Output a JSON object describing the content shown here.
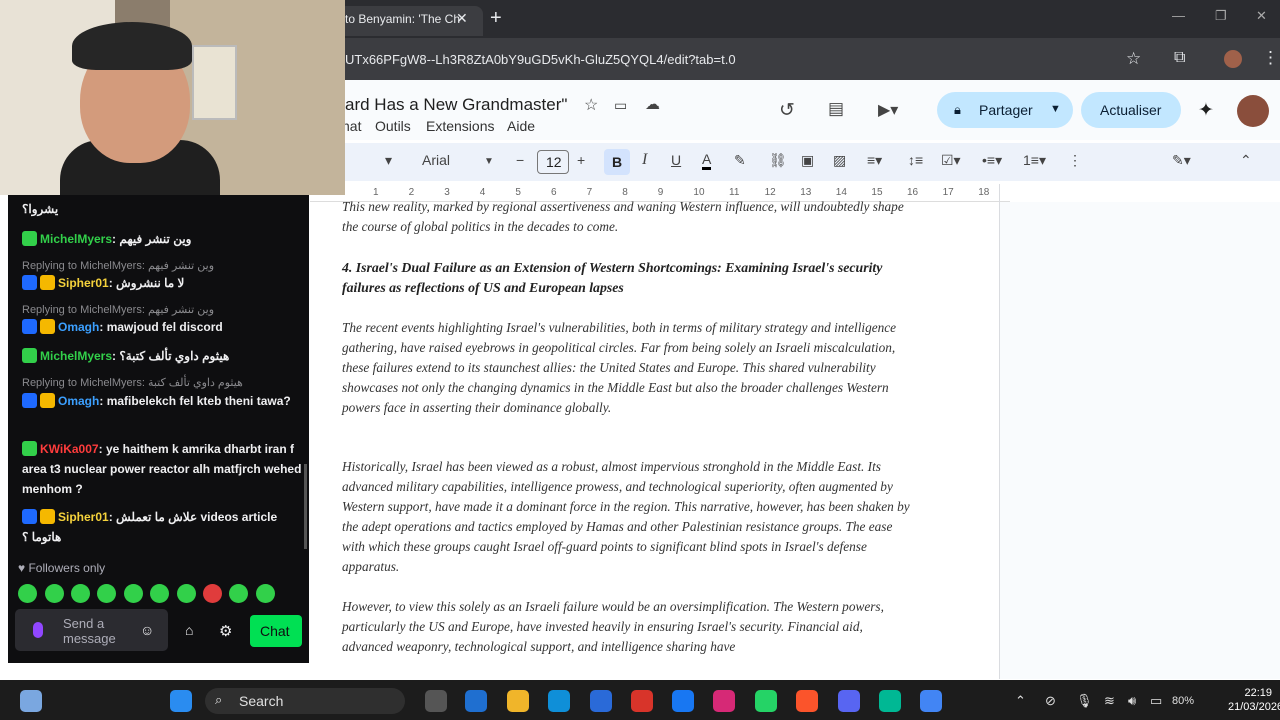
{
  "browser": {
    "tab_title": "to Benyamin: 'The Ch",
    "tab_close": "✕",
    "new_tab": "+",
    "url": "UTx66PFgW8--Lh3R8ZtA0bY9uGD5vKh-GluZ5QYQL4/edit?tab=t.0"
  },
  "docs": {
    "title": "ard Has a New Grandmaster\"",
    "menus": [
      "nat",
      "Outils",
      "Extensions",
      "Aide"
    ],
    "share_label": "Partager",
    "update_label": "Actualiser",
    "font_name": "Arial",
    "font_size": "12",
    "bold_label": "B",
    "italic_label": "I",
    "underline_label": "U",
    "text_color_label": "A",
    "ruler_numbers": [
      "1",
      "2",
      "3",
      "4",
      "5",
      "6",
      "7",
      "8",
      "9",
      "10",
      "11",
      "12",
      "13",
      "14",
      "15",
      "16",
      "17",
      "18"
    ]
  },
  "document": {
    "para_top": "This new reality, marked by regional assertiveness and waning Western influence, will undoubtedly shape the course of global politics in the decades to come.",
    "heading": "4.  Israel's Dual Failure as an Extension of Western Shortcomings:  Examining Israel's security failures as reflections of US and European lapses",
    "para1": "The recent events highlighting Israel's vulnerabilities, both in terms of military strategy and intelligence gathering, have raised eyebrows in geopolitical circles. Far from being solely an Israeli miscalculation, these failures extend to its staunchest allies: the United States and Europe. This shared vulnerability showcases not only the changing dynamics in the Middle East but also the broader challenges Western powers face in asserting their dominance globally.",
    "para2": "Historically, Israel has been viewed as a robust, almost impervious stronghold in the Middle East. Its advanced military capabilities, intelligence prowess, and technological superiority, often augmented by Western support, have made it a dominant force in the region. This narrative, however, has been shaken by the adept operations and tactics employed by Hamas and other Palestinian resistance groups. The ease with which these groups caught Israel off-guard points to significant blind spots in Israel's defense apparatus.",
    "para3": "However, to view this solely as an Israeli failure would be an oversimplification. The Western powers, particularly the US and Europe, have invested heavily in ensuring Israel's security. Financial aid, advanced weaponry, technological support, and intelligence sharing have"
  },
  "chat": {
    "messages": [
      {
        "user": "",
        "text": "يشروا؟",
        "color": "#efeff1"
      },
      {
        "user": "MichelMyers",
        "text": "وين تنشر فيهم",
        "color": "#32d04a"
      },
      {
        "reply": "Replying to MichelMyers: وين تنشر فيهم",
        "user": "Sipher01",
        "text": "لا ما ننشروش",
        "color": "#f5d23c"
      },
      {
        "reply": "Replying to MichelMyers: وين تنشر فيهم",
        "user": "Omagh",
        "text": "mawjoud fel discord",
        "color": "#3ca0ff"
      },
      {
        "user": "MichelMyers",
        "text": "هيثوم داوي تألف كتبة؟",
        "color": "#32d04a"
      },
      {
        "reply": "Replying to MichelMyers: هيثوم داوي تألف كتبة",
        "user": "Omagh",
        "text": "mafibelekch fel kteb theni tawa?",
        "color": "#3ca0ff"
      },
      {
        "user": "KWiKa007",
        "text": "ye haithem k amrika dharbt iran f area t3 nuclear power reactor alh matfjrch wehed menhom ?",
        "color": "#ff3c3c"
      },
      {
        "user": "Sipher01",
        "text": "علاش ما تعملش videos article ‏ هاتوما ؟",
        "color": "#f5d23c"
      }
    ],
    "followers_only": "Followers only",
    "input_placeholder": "Send a message",
    "chat_button": "Chat"
  },
  "taskbar": {
    "search_label": "Search",
    "time": "22:19",
    "date": "21/03/2026",
    "battery": "80%"
  }
}
